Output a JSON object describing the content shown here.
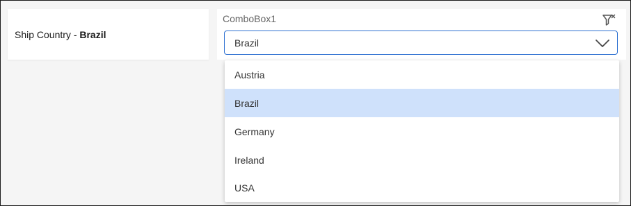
{
  "summary_card": {
    "prefix": "Ship Country - ",
    "value": "Brazil"
  },
  "combobox": {
    "title": "ComboBox1",
    "selected_value": "Brazil",
    "clear_filter_icon": "filter-clear-icon",
    "chevron_icon": "chevron-down-icon",
    "accent_color": "#2c6fd1"
  },
  "dropdown": {
    "items": [
      {
        "label": "Austria",
        "selected": false
      },
      {
        "label": "Brazil",
        "selected": true
      },
      {
        "label": "Germany",
        "selected": false
      },
      {
        "label": "Ireland",
        "selected": false
      },
      {
        "label": "USA",
        "selected": false
      }
    ],
    "selected_color": "#cfe1fb"
  }
}
